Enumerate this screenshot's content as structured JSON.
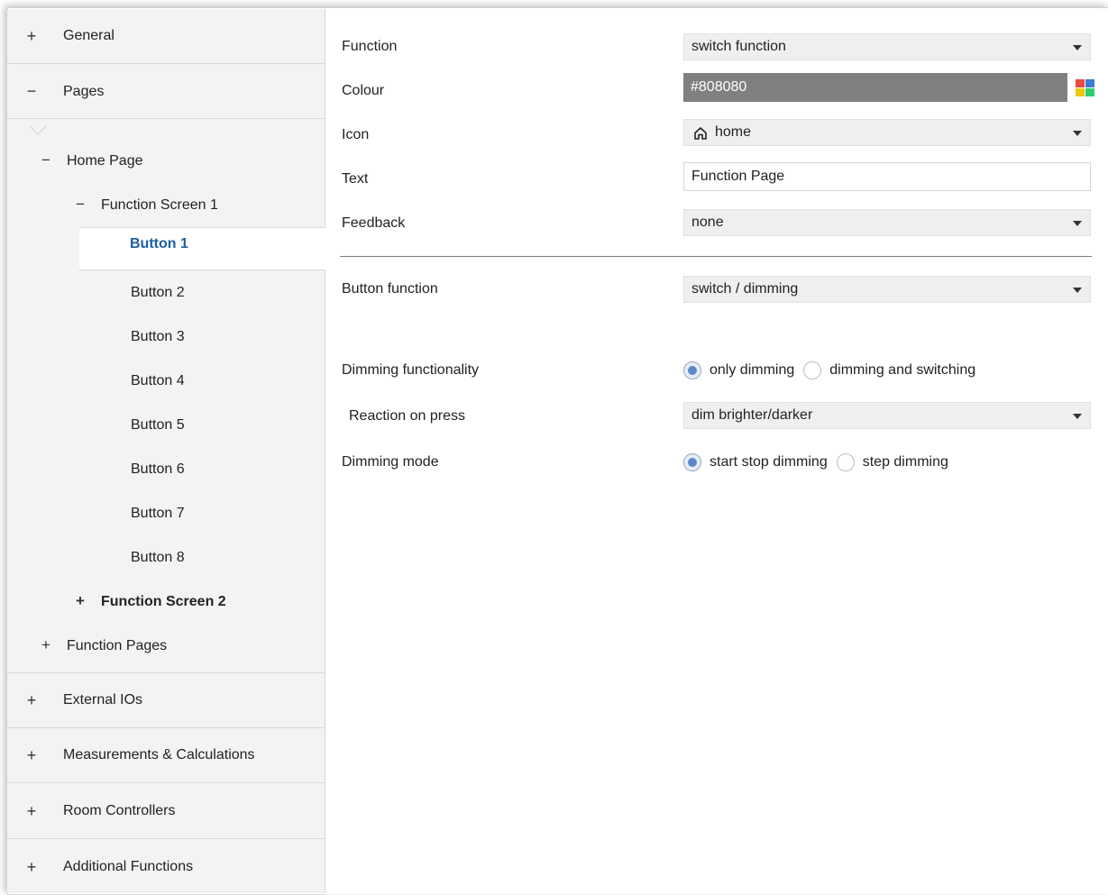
{
  "sidebar": {
    "sections": {
      "general": {
        "symbol": "+",
        "label": "General"
      },
      "pages": {
        "symbol": "−",
        "label": "Pages"
      },
      "external_ios": {
        "symbol": "+",
        "label": "External IOs"
      },
      "measurements": {
        "symbol": "+",
        "label": "Measurements & Calculations"
      },
      "room_controllers": {
        "symbol": "+",
        "label": "Room Controllers"
      },
      "additional_functions": {
        "symbol": "+",
        "label": "Additional Functions"
      }
    },
    "tree": {
      "home_page": {
        "symbol": "−",
        "label": "Home Page"
      },
      "function_screen_1": {
        "symbol": "−",
        "label": "Function Screen 1"
      },
      "buttons": [
        "Button 1",
        "Button 2",
        "Button 3",
        "Button 4",
        "Button 5",
        "Button 6",
        "Button 7",
        "Button 8"
      ],
      "function_screen_2": {
        "symbol": "+",
        "label": "Function Screen 2"
      },
      "function_pages": {
        "symbol": "+",
        "label": "Function Pages"
      }
    }
  },
  "main": {
    "function": {
      "label": "Function",
      "value": "switch function"
    },
    "colour": {
      "label": "Colour",
      "value": "#808080",
      "swatch": "#808080"
    },
    "icon": {
      "label": "Icon",
      "value": "home",
      "icon_name": "home-icon"
    },
    "text": {
      "label": "Text",
      "value": "Function Page"
    },
    "feedback": {
      "label": "Feedback",
      "value": "none"
    },
    "button_function": {
      "label": "Button function",
      "value": "switch / dimming"
    },
    "dimming_functionality": {
      "label": "Dimming functionality",
      "options": [
        "only dimming",
        "dimming and switching"
      ],
      "selected": "only dimming"
    },
    "reaction_on_press": {
      "label": "Reaction on press",
      "value": "dim brighter/darker"
    },
    "dimming_mode": {
      "label": "Dimming mode",
      "options": [
        "start stop dimming",
        "step dimming"
      ],
      "selected": "start stop dimming"
    }
  },
  "colors": {
    "selected_text": "#1e5fa3",
    "sidebar_bg": "#f3f3f3",
    "radio_selected": "#5b88c6"
  }
}
